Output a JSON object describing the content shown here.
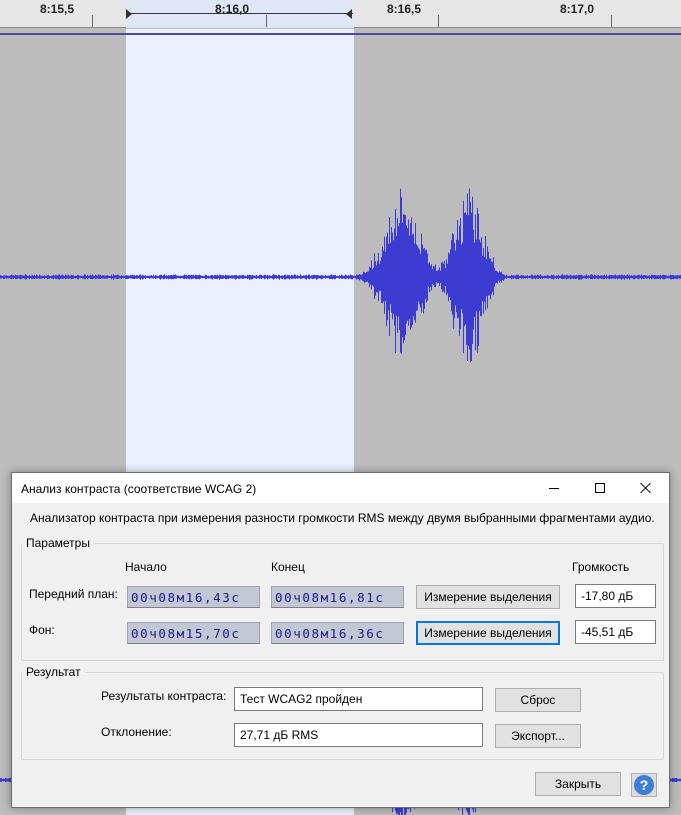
{
  "ruler": {
    "labels": [
      "8:15,5",
      "8:16,0",
      "8:16,5",
      "8:17,0"
    ]
  },
  "dialog": {
    "title": "Анализ контраста (соответствие WCAG 2)",
    "description": "Анализатор контраста при измерения разности громкости RMS между двумя выбранными фрагментами аудио.",
    "params": {
      "group_label": "Параметры",
      "col_start": "Начало",
      "col_end": "Конец",
      "col_volume": "Громкость",
      "foreground": {
        "label": "Передний план:",
        "start": "00ч08м16,43с",
        "end": "00ч08м16,81с",
        "measure_label": "Измерение выделения",
        "volume": "-17,80 дБ"
      },
      "background": {
        "label": "Фон:",
        "start": "00ч08м15,70с",
        "end": "00ч08м16,36с",
        "measure_label": "Измерение выделения",
        "volume": "-45,51 дБ"
      }
    },
    "result": {
      "group_label": "Результат",
      "contrast_label": "Результаты контраста:",
      "contrast_value": "Тест WCAG2 пройден",
      "reset_label": "Сброс",
      "deviation_label": "Отклонение:",
      "deviation_value": "27,71 дБ RMS",
      "export_label": "Экспорт..."
    },
    "close_label": "Закрыть",
    "help_glyph": "?"
  },
  "colors": {
    "waveform": "#3c3cd2",
    "selection": "#e9effc",
    "focus": "#0078d7"
  }
}
